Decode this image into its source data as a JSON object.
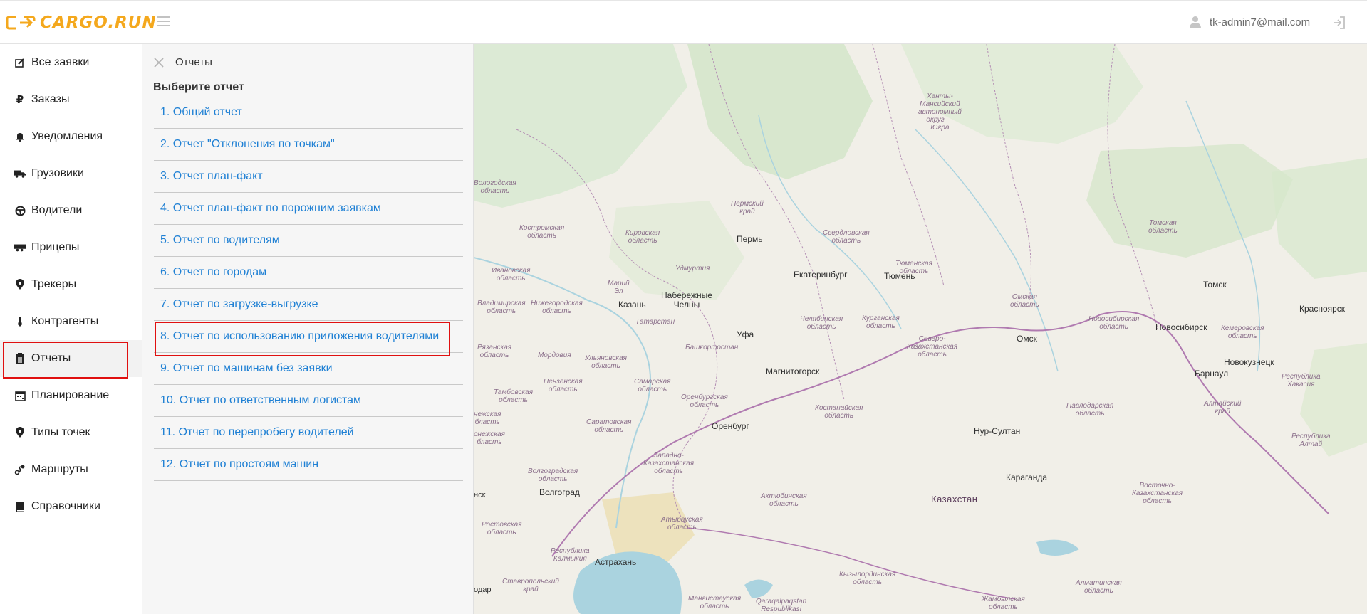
{
  "header": {
    "logo_text": "CARGO.RUN",
    "user_email": "tk-admin7@mail.com",
    "icons": {
      "menu": "hamburger-icon",
      "user": "user-icon",
      "logout": "logout-icon"
    }
  },
  "sidebar": {
    "items": [
      {
        "label": "Все заявки",
        "icon": "edit-icon"
      },
      {
        "label": "Заказы",
        "icon": "ruble-icon"
      },
      {
        "label": "Уведомления",
        "icon": "bell-icon"
      },
      {
        "label": "Грузовики",
        "icon": "truck-icon"
      },
      {
        "label": "Водители",
        "icon": "steering-wheel-icon"
      },
      {
        "label": "Прицепы",
        "icon": "trailer-icon"
      },
      {
        "label": "Трекеры",
        "icon": "map-pin-icon"
      },
      {
        "label": "Контрагенты",
        "icon": "tie-icon"
      },
      {
        "label": "Отчеты",
        "icon": "clipboard-icon",
        "active": true
      },
      {
        "label": "Планирование",
        "icon": "calendar-icon"
      },
      {
        "label": "Типы точек",
        "icon": "map-pin-icon"
      },
      {
        "label": "Маршруты",
        "icon": "route-icon"
      },
      {
        "label": "Справочники",
        "icon": "book-icon"
      }
    ]
  },
  "reports": {
    "title": "Отчеты",
    "subtitle": "Выберите отчет",
    "items": [
      "1. Общий отчет",
      "2. Отчет \"Отклонения по точкам\"",
      "3. Отчет план-факт",
      "4. Отчет план-факт по порожним заявкам",
      "5. Отчет по водителям",
      "6. Отчет по городам",
      "7. Отчет по загрузке-выгрузке",
      "8. Отчет по использованию приложения водителями",
      "9. Отчет по машинам без заявки",
      "10. Отчет по ответственным логистам",
      "11. Отчет по перепробегу водителей",
      "12. Отчет по простоям машин"
    ],
    "highlighted_index": 7
  },
  "map": {
    "cities": [
      "Пермь",
      "Екатеринбург",
      "Тюмень",
      "Казань",
      "Набережные\nЧелны",
      "Уфа",
      "Магнитогорск",
      "Оренбург",
      "Омск",
      "Томск",
      "Новосибирск",
      "Красноярск",
      "Новокузнецк",
      "Барнаул",
      "Нур-Султан",
      "Караганда",
      "Волгоград",
      "Астрахань"
    ],
    "country": "Казахстан",
    "regions": [
      "Ханты-\nМансийский\nавтономный\nокруг —\nЮгра",
      "Пермский\nкрай",
      "Кировская\nобласть",
      "Свердловская\nобласть",
      "Тюменская\nобласть",
      "Томская\nобласть",
      "Костромская\nобласть",
      "Ивановская\nобласть",
      "Удмуртия",
      "Марий\nЭл",
      "Владимирская\nобласть",
      "Нижегородская\nобласть",
      "Татарстан",
      "Челябинская\nобласть",
      "Курганская\nобласть",
      "Омская\nобласть",
      "Новосибирская\nобласть",
      "Кемеровская\nобласть",
      "Рязанская\nобласть",
      "Мордовия",
      "Ульяновская\nобласть",
      "Башкортостан",
      "Северо-\nКазахстанская\nобласть",
      "Пензенская\nобласть",
      "Самарская\nобласть",
      "Тамбовская\nобласть",
      "Оренбургская\nобласть",
      "Костанайская\nобласть",
      "Павлодарская\nобласть",
      "Алтайский\nкрай",
      "Республика\nХакасия",
      "Саратовская\nобласть",
      "Западно-\nКазахстанская\nобласть",
      "Республика\nАлтай",
      "Волгоградская\nобласть",
      "Актюбинская\nобласть",
      "Восточно-\nКазахстанская\nобласть",
      "Ростовская\nобласть",
      "Атырауская\nобласть",
      "Республика\nКалмыкия",
      "Ставропольский\nкрай",
      "Мангистауская\nобласть",
      "Кызылординская\nобласть",
      "Qaraqalpaqstan\nRespublikasi",
      "Алматинская\nобласть",
      "Жамбылская\nобласть",
      "Вологодская\nобласть",
      "нежская\nбласть",
      "онежская\nбласть",
      "нск",
      "одар"
    ]
  }
}
